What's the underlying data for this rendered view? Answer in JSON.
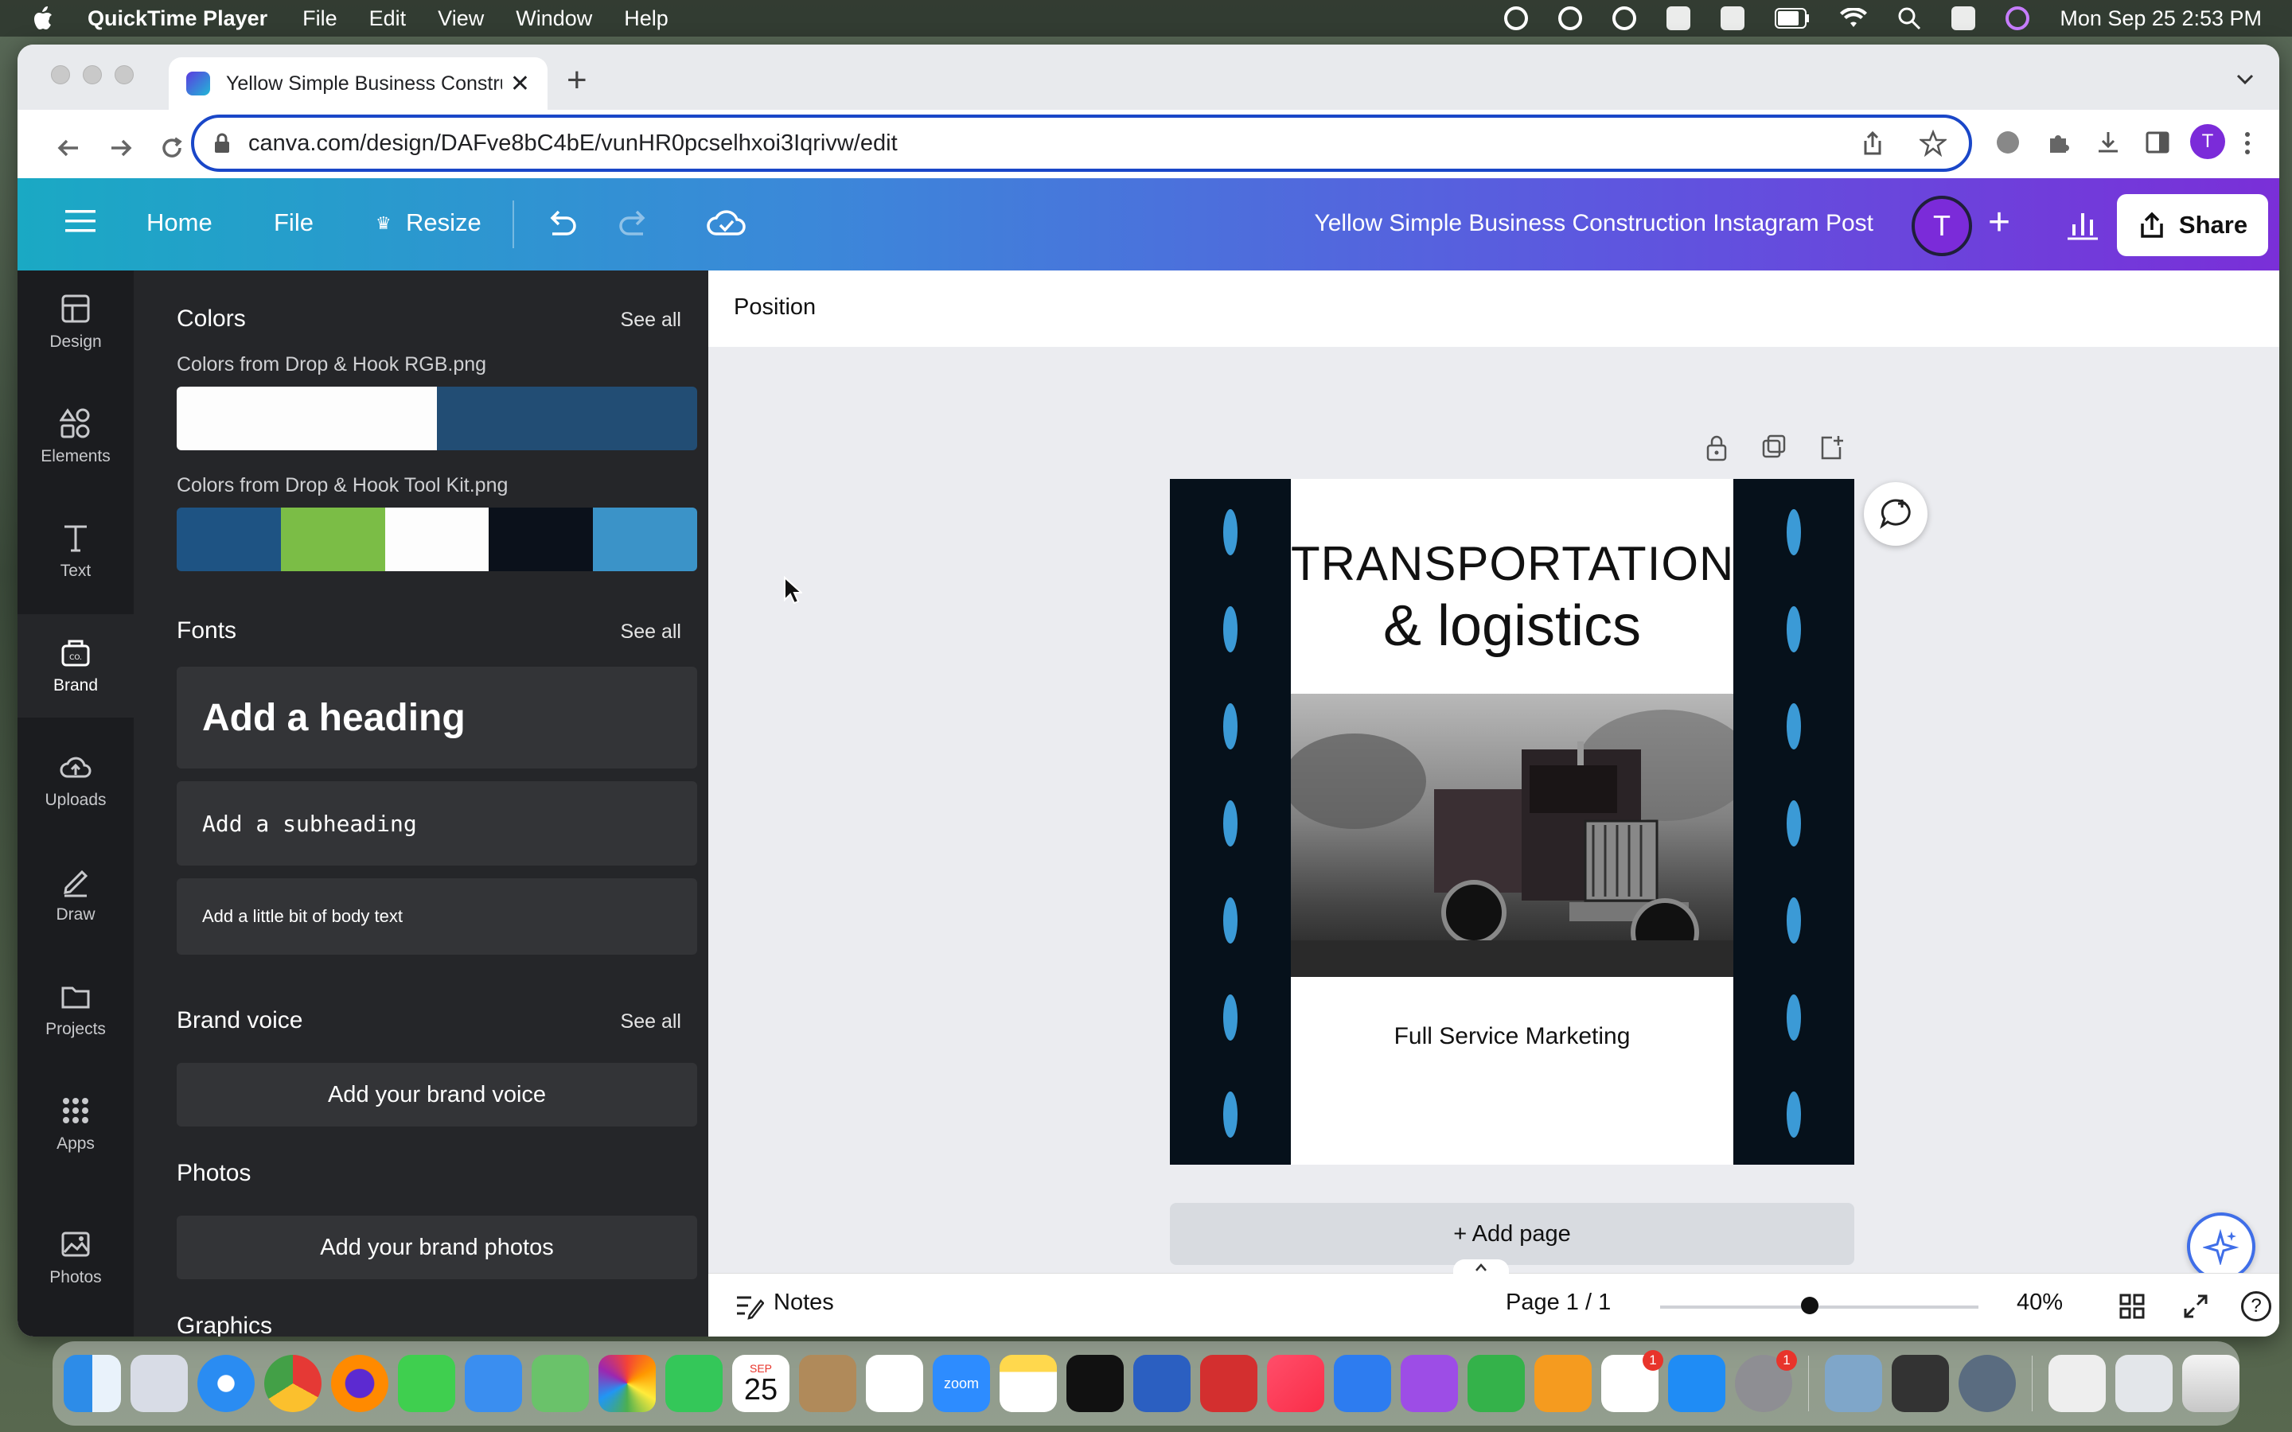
{
  "menubar": {
    "app_name": "QuickTime Player",
    "menus": [
      "File",
      "Edit",
      "View",
      "Window",
      "Help"
    ],
    "clock": "Mon Sep 25  2:53 PM"
  },
  "browser": {
    "tab_title": "Yellow Simple Business Construction Instagram Post",
    "new_tab": "+",
    "url": "canva.com/design/DAFve8bC4bE/vunHR0pcselhxoi3Iqrivw/edit",
    "profile_initial": "T"
  },
  "canva_header": {
    "home": "Home",
    "file": "File",
    "resize": "Resize",
    "doc_title": "Yellow Simple Business Construction Instagram Post",
    "avatar_initial": "T",
    "plus": "+",
    "share": "Share",
    "accent": "#7a2fd8",
    "gradient_start": "#1aa9c4"
  },
  "rail": {
    "items": [
      {
        "label": "Design",
        "icon": "layout-icon"
      },
      {
        "label": "Elements",
        "icon": "shapes-icon"
      },
      {
        "label": "Text",
        "icon": "text-icon"
      },
      {
        "label": "Brand",
        "icon": "brand-icon"
      },
      {
        "label": "Uploads",
        "icon": "cloud-upload-icon"
      },
      {
        "label": "Draw",
        "icon": "pen-icon"
      },
      {
        "label": "Projects",
        "icon": "folder-icon"
      },
      {
        "label": "Apps",
        "icon": "apps-grid-icon"
      },
      {
        "label": "Photos",
        "icon": "image-icon"
      }
    ],
    "active": "Brand"
  },
  "panel": {
    "colors": {
      "title": "Colors",
      "see_all": "See all",
      "palette1_label": "Colors from Drop & Hook RGB.png",
      "palette1": [
        "#fdfdfd",
        "#224d74"
      ],
      "palette2_label": "Colors from Drop & Hook Tool Kit.png",
      "palette2": [
        "#1e5383",
        "#7bbd46",
        "#fdfdfd",
        "#0b111b",
        "#3b93c8"
      ]
    },
    "fonts": {
      "title": "Fonts",
      "see_all": "See all",
      "heading": "Add a heading",
      "subheading": "Add a subheading",
      "body": "Add a little bit of body text"
    },
    "brand_voice": {
      "title": "Brand voice",
      "see_all": "See all",
      "button": "Add your brand voice"
    },
    "photos": {
      "title": "Photos",
      "button": "Add your brand photos"
    },
    "graphics": {
      "title": "Graphics"
    }
  },
  "editor": {
    "toolbar_label": "Position",
    "design": {
      "headline_line1": "TRANSPORTATION",
      "headline_line2": "& logistics",
      "tagline": "Full Service Marketing",
      "road_color": "#06111b",
      "dash_color": "#3b9ad6"
    },
    "add_page": "+ Add page",
    "footer": {
      "notes": "Notes",
      "page_indicator": "Page 1 / 1",
      "zoom": "40%",
      "zoom_level": 0.4,
      "help": "?"
    }
  },
  "dock": {
    "calendar_month": "SEP",
    "calendar_day": "25",
    "zoom_label": "zoom",
    "badge_slack": "1",
    "badge_settings": "1"
  }
}
